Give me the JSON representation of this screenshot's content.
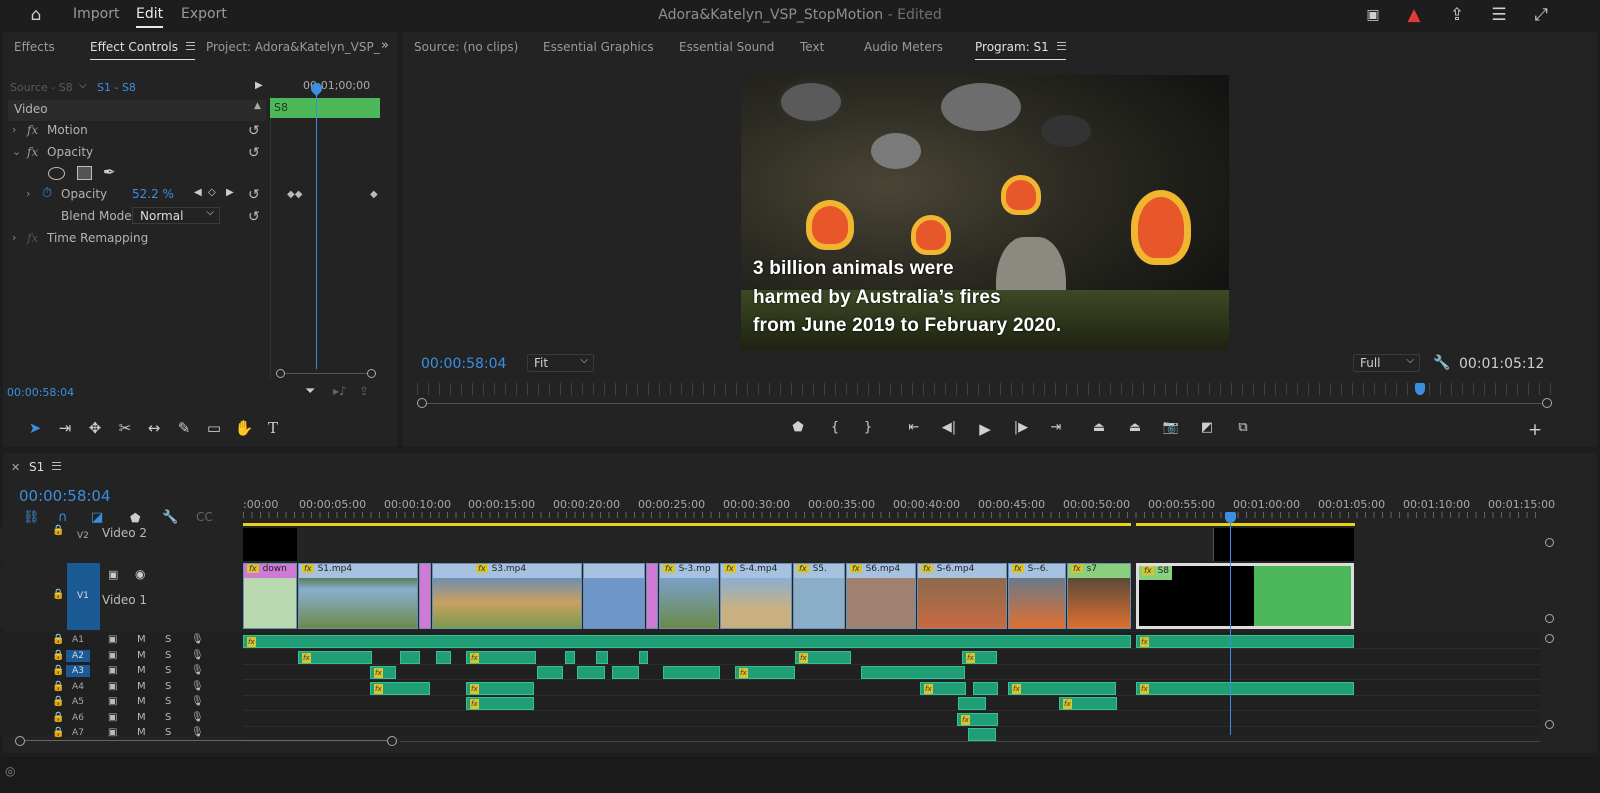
{
  "topbar": {
    "nav": [
      "Import",
      "Edit",
      "Export"
    ],
    "active": "Edit",
    "title": "Adora&Katelyn_VSP_StopMotion",
    "edited": "- Edited"
  },
  "leftpanel": {
    "tabs": [
      "Effects",
      "Effect Controls",
      "Project: Adora&Katelyn_VSP_"
    ],
    "source": "Source - S8",
    "sequence": "S1 - S8",
    "timecode_head": "00;01;00;00",
    "clip": "S8",
    "section": "Video",
    "rows": {
      "motion": "Motion",
      "opacity": "Opacity",
      "opacity_prop": "Opacity",
      "opacity_val": "52.2 %",
      "blend": "Blend Mode",
      "blend_val": "Normal",
      "time_remap": "Time Remapping"
    },
    "timecode": "00:00:58:04"
  },
  "monitor": {
    "tabs": [
      "Source: (no clips)",
      "Essential Graphics",
      "Essential Sound",
      "Text",
      "Audio Meters",
      "Program: S1"
    ],
    "caption": [
      "3 billion animals were",
      "harmed by Australia’s fires",
      "from June 2019 to February 2020."
    ],
    "timecode": "00:00:58:04",
    "fit": "Fit",
    "quality": "Full",
    "duration": "00:01:05:12"
  },
  "timeline": {
    "seq": "S1",
    "timecode": "00:00:58:04",
    "ticks": [
      ":00:00",
      "00:00:05:00",
      "00:00:10:00",
      "00:00:15:00",
      "00:00:20:00",
      "00:00:25:00",
      "00:00:30:00",
      "00:00:35:00",
      "00:00:40:00",
      "00:00:45:00",
      "00:00:50:00",
      "00:00:55:00",
      "00:01:00:00",
      "00:01:05:00",
      "00:01:10:00",
      "00:01:15:00"
    ],
    "v2": {
      "id": "V2",
      "name": "Video 2"
    },
    "v1": {
      "id": "V1",
      "name": "Video 1"
    },
    "audio": [
      "A1",
      "A2",
      "A3",
      "A4",
      "A5",
      "A6",
      "A7"
    ],
    "clips": [
      "down",
      "S1.mp4",
      "S3.mp4",
      "S-3.mp",
      "S-4.mp4",
      "S5.",
      "S6.mp4",
      "S-6.mp4",
      "S--6.",
      "s7",
      "S8"
    ],
    "m": "M",
    "s": "S"
  },
  "colors": {
    "accent": "#3a8fe0",
    "clip_green": "#4cb85a",
    "audio": "#1f9e78",
    "yellow_bar": "#e8d31a",
    "pink": "#d07ad8"
  }
}
